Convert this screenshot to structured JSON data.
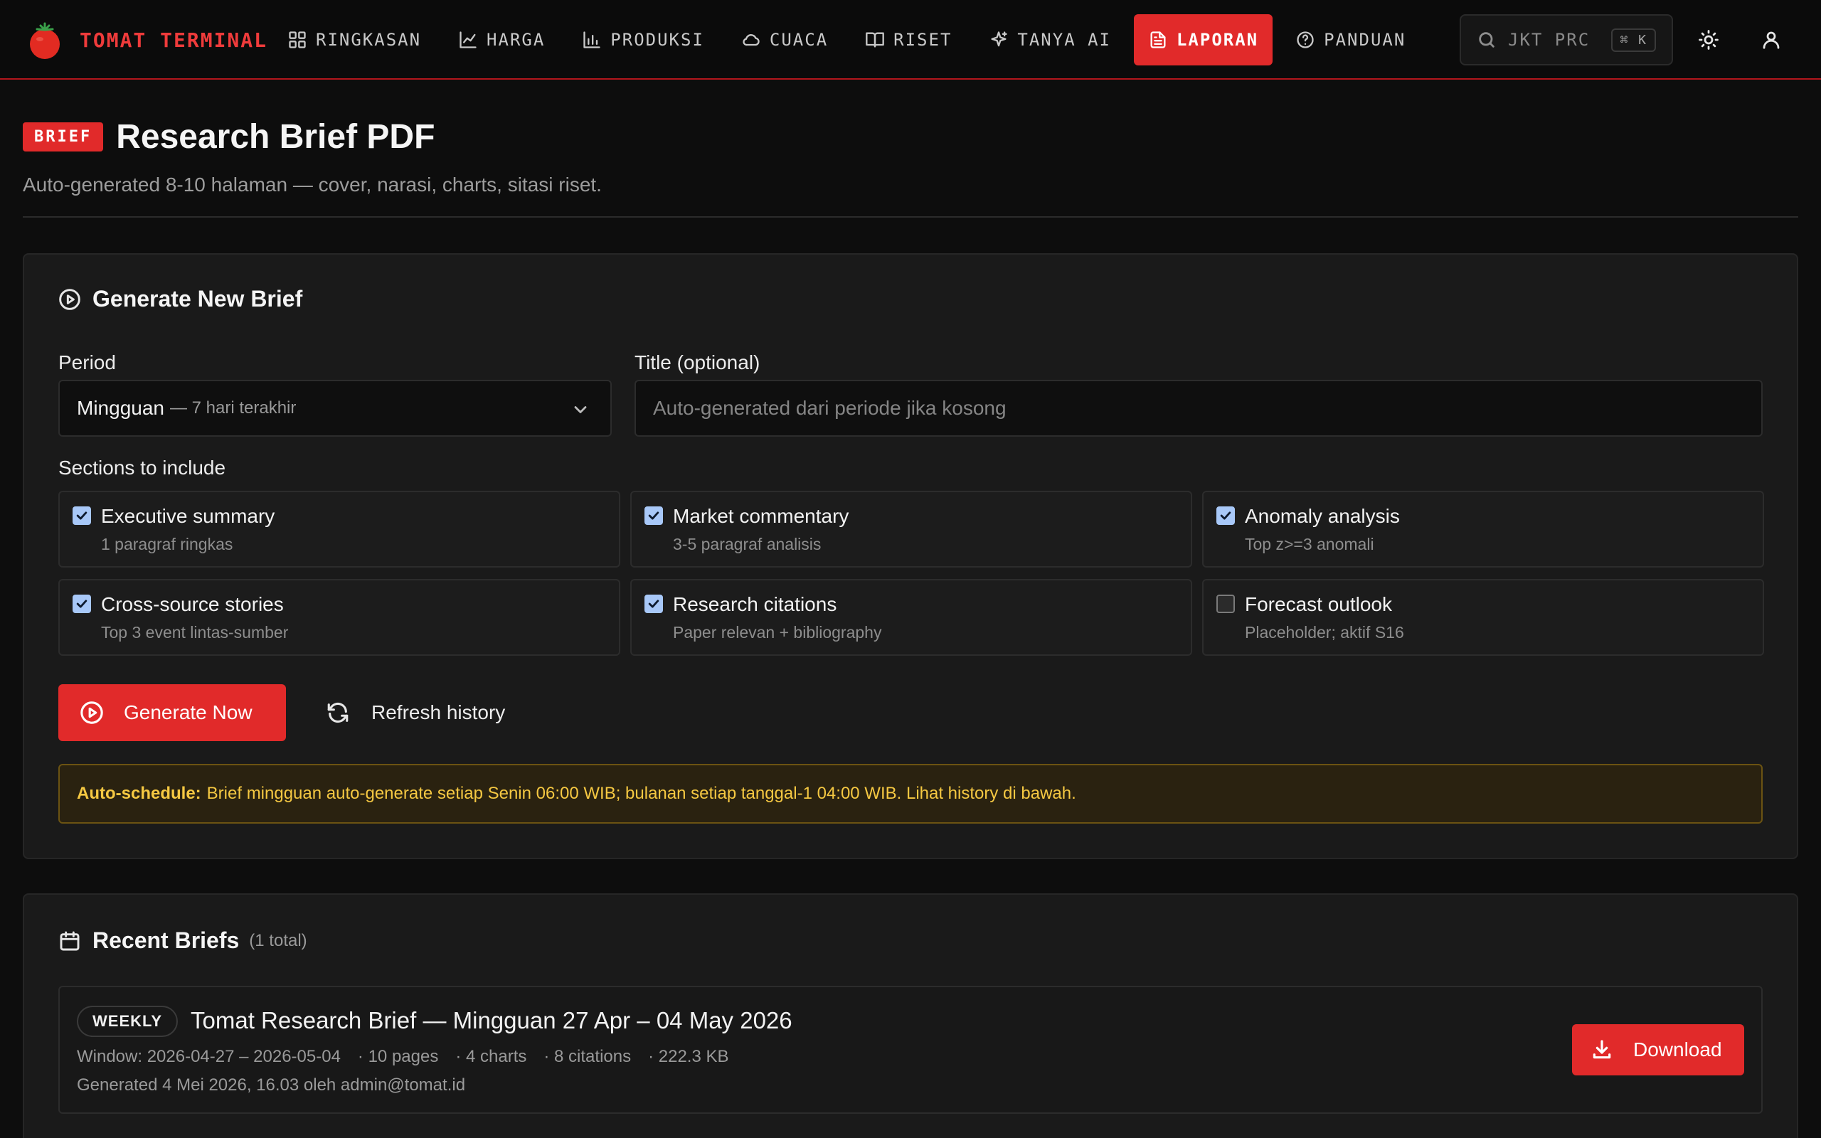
{
  "brand": {
    "name": "TOMAT TERMINAL",
    "icon": "tomato-icon"
  },
  "nav": {
    "items": [
      {
        "id": "ringkasan",
        "label": "RINGKASAN",
        "icon": "grid-icon"
      },
      {
        "id": "harga",
        "label": "HARGA",
        "icon": "line-chart-icon"
      },
      {
        "id": "produksi",
        "label": "PRODUKSI",
        "icon": "bar-chart-icon"
      },
      {
        "id": "cuaca",
        "label": "CUACA",
        "icon": "cloud-icon"
      },
      {
        "id": "riset",
        "label": "RISET",
        "icon": "book-icon"
      },
      {
        "id": "tanya-ai",
        "label": "TANYA AI",
        "icon": "sparkle-icon"
      },
      {
        "id": "laporan",
        "label": "LAPORAN",
        "icon": "document-icon",
        "active": true
      },
      {
        "id": "panduan",
        "label": "PANDUAN",
        "icon": "help-icon"
      }
    ],
    "search": {
      "text": "JKT PRC",
      "shortcut": "⌘ K"
    }
  },
  "header": {
    "badge": "BRIEF",
    "title": "Research Brief PDF",
    "subtitle": "Auto-generated 8-10 halaman — cover, narasi, charts, sitasi riset."
  },
  "generate": {
    "title": "Generate New Brief",
    "period_label": "Period",
    "period_value": "Mingguan",
    "period_hint": "— 7 hari terakhir",
    "title_label": "Title (optional)",
    "title_placeholder": "Auto-generated dari periode jika kosong",
    "title_value": "",
    "sections_label": "Sections to include",
    "sections": [
      {
        "title": "Executive summary",
        "desc": "1 paragraf ringkas",
        "checked": true
      },
      {
        "title": "Market commentary",
        "desc": "3-5 paragraf analisis",
        "checked": true
      },
      {
        "title": "Anomaly analysis",
        "desc": "Top z>=3 anomali",
        "checked": true
      },
      {
        "title": "Cross-source stories",
        "desc": "Top 3 event lintas-sumber",
        "checked": true
      },
      {
        "title": "Research citations",
        "desc": "Paper relevan + bibliography",
        "checked": true
      },
      {
        "title": "Forecast outlook",
        "desc": "Placeholder; aktif S16",
        "checked": false
      }
    ],
    "generate_label": "Generate Now",
    "refresh_label": "Refresh history",
    "notice_bold": "Auto-schedule:",
    "notice_text": "Brief mingguan auto-generate setiap Senin 06:00 WIB; bulanan setiap tanggal-1 04:00 WIB. Lihat history di bawah."
  },
  "recent": {
    "title": "Recent Briefs",
    "count": "(1 total)",
    "items": [
      {
        "tag": "WEEKLY",
        "title": "Tomat Research Brief — Mingguan 27 Apr – 04 May 2026",
        "window": "Window: 2026-04-27 – 2026-05-04",
        "pages": "· 10 pages",
        "charts": "· 4 charts",
        "citations": "· 8 citations",
        "size": "· 222.3 KB",
        "generated": "Generated 4 Mei 2026, 16.03 oleh admin@tomat.id",
        "download_label": "Download"
      }
    ]
  },
  "colors": {
    "accent": "#e12a2a",
    "background": "#0d0d0d",
    "card": "#1a1a1a",
    "notice": "#f5c842"
  }
}
